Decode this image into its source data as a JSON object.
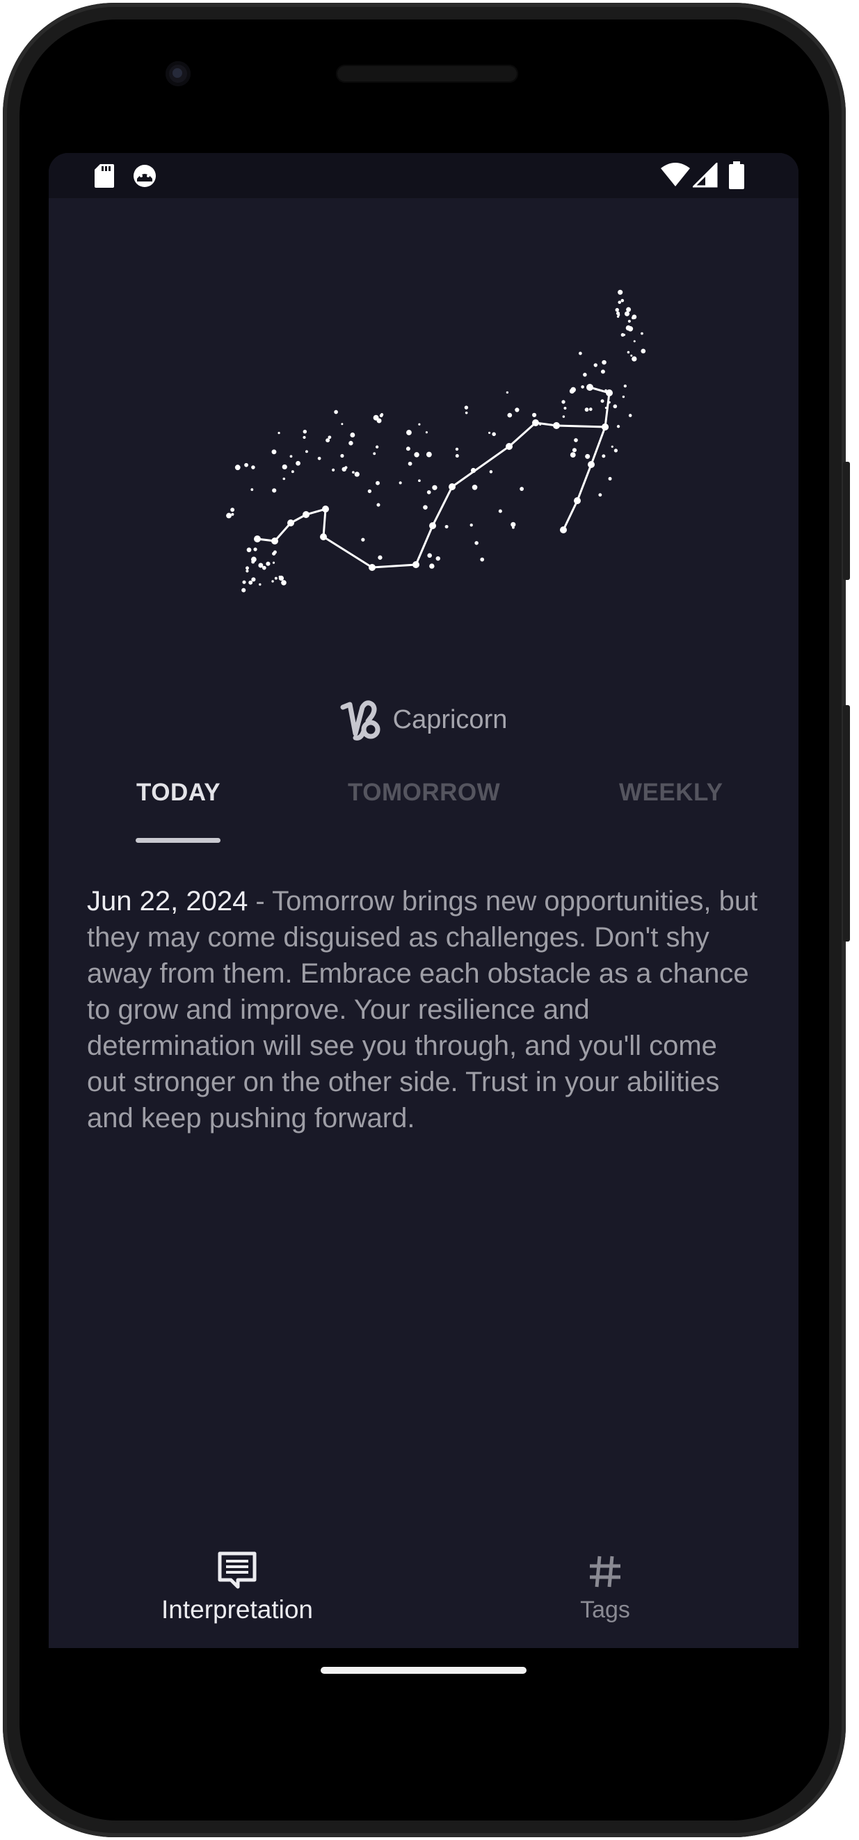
{
  "zodiac": {
    "symbol": "♑",
    "name": "Capricorn"
  },
  "tabs": [
    {
      "label": "TODAY",
      "active": true
    },
    {
      "label": "TOMORROW",
      "active": false
    },
    {
      "label": "WEEKLY",
      "active": false
    }
  ],
  "horoscope": {
    "date": "Jun 22, 2024",
    "separator": " - ",
    "text": "Tomorrow brings new opportunities, but they may come disguised as challenges. Don't shy away from them. Embrace each obstacle as a chance to grow and improve. Your resilience and determination will see you through, and you'll come out stronger on the other side. Trust in your abilities and keep pushing forward."
  },
  "bottom_nav": [
    {
      "label": "Interpretation",
      "icon": "comment-icon",
      "active": true
    },
    {
      "label": "Tags",
      "icon": "hashtag-icon",
      "active": false
    }
  ],
  "colors": {
    "background": "#191927",
    "active_text": "#ececf0",
    "inactive_text": "#55555f"
  }
}
